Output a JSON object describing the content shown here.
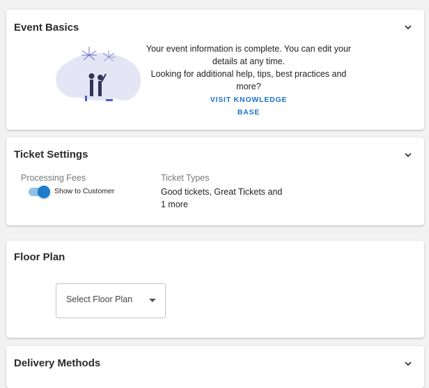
{
  "event_basics": {
    "title": "Event Basics",
    "message": "Your event information is complete. You can edit your details at any time.",
    "help_prompt": "Looking for additional help, tips, best practices and more?",
    "kb_link": "VISIT KNOWLEDGE BASE",
    "icon": "chevron-down-icon"
  },
  "ticket_settings": {
    "title": "Ticket Settings",
    "processing_fees_label": "Processing Fees",
    "toggle_label": "Show to Customer",
    "toggle_on": true,
    "ticket_types_label": "Ticket Types",
    "ticket_types_value": "Good tickets, Great Tickets and 1 more",
    "icon": "chevron-down-icon"
  },
  "floor_plan": {
    "title": "Floor Plan",
    "select_placeholder": "Select Floor Plan"
  },
  "delivery_methods": {
    "title": "Delivery Methods",
    "icon": "chevron-down-icon"
  },
  "colors": {
    "accent": "#1d7ccc",
    "link": "#1a73c8",
    "background": "#f2f2f2"
  }
}
